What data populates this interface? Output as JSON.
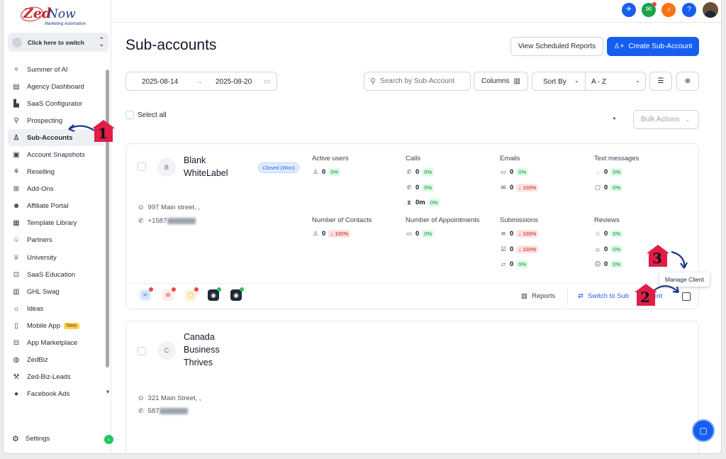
{
  "logo": {
    "brand_zed": "Zed",
    "brand_now": "Now",
    "tagline": "Marketing Automation"
  },
  "switcher": {
    "label": "Click here to switch"
  },
  "sidebar": {
    "items": [
      {
        "label": "Summer of AI",
        "icon": "sparkle-icon"
      },
      {
        "label": "Agency Dashboard",
        "icon": "dashboard-icon"
      },
      {
        "label": "SaaS Configurator",
        "icon": "bar-chart-icon"
      },
      {
        "label": "Prospecting",
        "icon": "prospect-icon"
      },
      {
        "label": "Sub-Accounts",
        "icon": "user-icon",
        "active": true
      },
      {
        "label": "Account Snapshots",
        "icon": "snapshot-icon"
      },
      {
        "label": "Reselling",
        "icon": "reselling-icon"
      },
      {
        "label": "Add-Ons",
        "icon": "addons-icon"
      },
      {
        "label": "Affiliate Portal",
        "icon": "users-icon"
      },
      {
        "label": "Template Library",
        "icon": "library-icon"
      },
      {
        "label": "Partners",
        "icon": "handshake-icon"
      },
      {
        "label": "University",
        "icon": "graduation-cap-icon"
      },
      {
        "label": "SaaS Education",
        "icon": "education-icon"
      },
      {
        "label": "GHL Swag",
        "icon": "swag-icon"
      },
      {
        "label": "Ideas",
        "icon": "lightbulb-icon"
      },
      {
        "label": "Mobile App",
        "icon": "mobile-icon",
        "badge": "New"
      },
      {
        "label": "App Marketplace",
        "icon": "marketplace-icon"
      },
      {
        "label": "ZedBiz",
        "icon": "zedbiz-icon"
      },
      {
        "label": "Zed-Biz-Leads",
        "icon": "wrench-icon"
      },
      {
        "label": "Facebook Ads",
        "icon": "facebook-icon"
      }
    ],
    "settings_label": "Settings"
  },
  "header": {
    "title": "Sub-accounts",
    "view_reports_label": "View Scheduled Reports",
    "create_label": "Create Sub-Account"
  },
  "filters": {
    "date_from": "2025-08-14",
    "date_to": "2025-08-20",
    "search_placeholder": "Search by Sub-Account",
    "columns_label": "Columns",
    "sort_by_label": "Sort By",
    "sort_value": "A - Z",
    "select_all_label": "Select all",
    "bulk_actions_label": "Bulk Actions"
  },
  "accounts": [
    {
      "initial": "B",
      "name": "Blank WhiteLabel",
      "status": "Closed (Won)",
      "address": "997 Main street, ,",
      "phone_prefix": "+1587",
      "metrics": {
        "active_users": {
          "title": "Active users",
          "value": "0",
          "pct": "0%"
        },
        "calls": {
          "title": "Calls",
          "rows": [
            {
              "value": "0",
              "pct": "0%"
            },
            {
              "value": "0",
              "pct": "0%"
            },
            {
              "value": "0m",
              "pct": "0%"
            }
          ]
        },
        "emails": {
          "title": "Emails",
          "rows": [
            {
              "value": "0",
              "pct": "0%"
            },
            {
              "value": "0",
              "pct": "100%",
              "down": true
            }
          ]
        },
        "texts": {
          "title": "Text messages",
          "rows": [
            {
              "value": "0",
              "pct": "0%"
            },
            {
              "value": "0",
              "pct": "0%"
            }
          ]
        },
        "contacts": {
          "title": "Number of Contacts",
          "value": "0",
          "pct": "100%",
          "down": true
        },
        "appointments": {
          "title": "Number of Appointments",
          "value": "0",
          "pct": "0%"
        },
        "submissions": {
          "title": "Submissions",
          "rows": [
            {
              "value": "0",
              "pct": "100%",
              "down": true
            },
            {
              "value": "0",
              "pct": "100%",
              "down": true
            },
            {
              "value": "0",
              "pct": "0%"
            }
          ]
        },
        "reviews": {
          "title": "Reviews",
          "rows": [
            {
              "value": "0",
              "pct": "0%"
            },
            {
              "value": "0",
              "pct": "0%"
            },
            {
              "value": "0",
              "pct": "0%"
            }
          ]
        }
      },
      "footer": {
        "reports_label": "Reports",
        "switch_label": "Switch to Sub",
        "switch_tail": "ent"
      }
    },
    {
      "initial": "C",
      "name": "Canada Business Thrives",
      "address": "321 Main Street, ,",
      "phone_prefix": "587"
    }
  ],
  "tooltip": {
    "manage_client": "Manage Client"
  },
  "steps": {
    "one": "1",
    "two": "2",
    "three": "3"
  },
  "colors": {
    "primary": "#155eef",
    "marker": "#e11d48",
    "positive": "#15803d",
    "negative": "#b91c1c"
  }
}
